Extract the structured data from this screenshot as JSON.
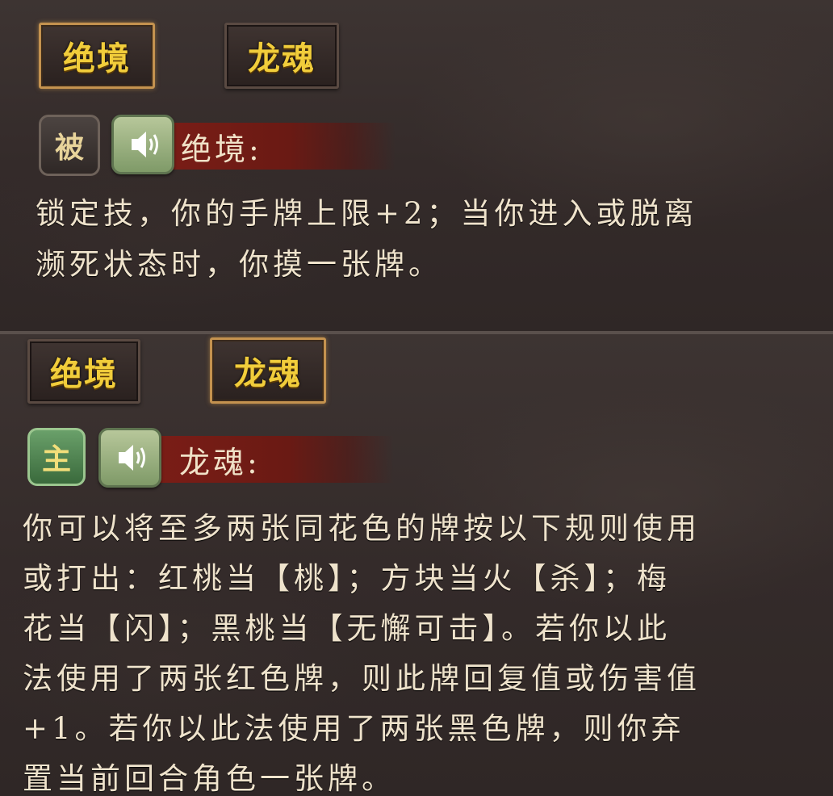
{
  "top_panel": {
    "tabs": [
      {
        "label": "绝境",
        "active": true
      },
      {
        "label": "龙魂",
        "active": false
      }
    ],
    "skill": {
      "type_badge": "被",
      "name": "绝境:",
      "description_lines": [
        "锁定技，你的手牌上限+2；当你进入或脱离",
        "濒死状态时，你摸一张牌。"
      ]
    }
  },
  "bottom_panel": {
    "tabs": [
      {
        "label": "绝境",
        "active": false
      },
      {
        "label": "龙魂",
        "active": true
      }
    ],
    "skill": {
      "type_badge": "主",
      "name": "龙魂:",
      "description_lines": [
        "你可以将至多两张同花色的牌按以下规则使用",
        "或打出：红桃当【桃】；方块当火【杀】；梅",
        "花当【闪】；黑桃当【无懈可击】。若你以此",
        "法使用了两张红色牌，则此牌回复值或伤害值",
        "+1。若你以此法使用了两张黑色牌，则你弃",
        "置当前回合角色一张牌。"
      ]
    }
  },
  "colors": {
    "tab_text": "#f1cd3b",
    "ribbon": "#7a1d16",
    "description_text": "#efe3cc",
    "active_badge": "#3a6a3c"
  },
  "icons": {
    "speaker": "speaker-icon"
  }
}
